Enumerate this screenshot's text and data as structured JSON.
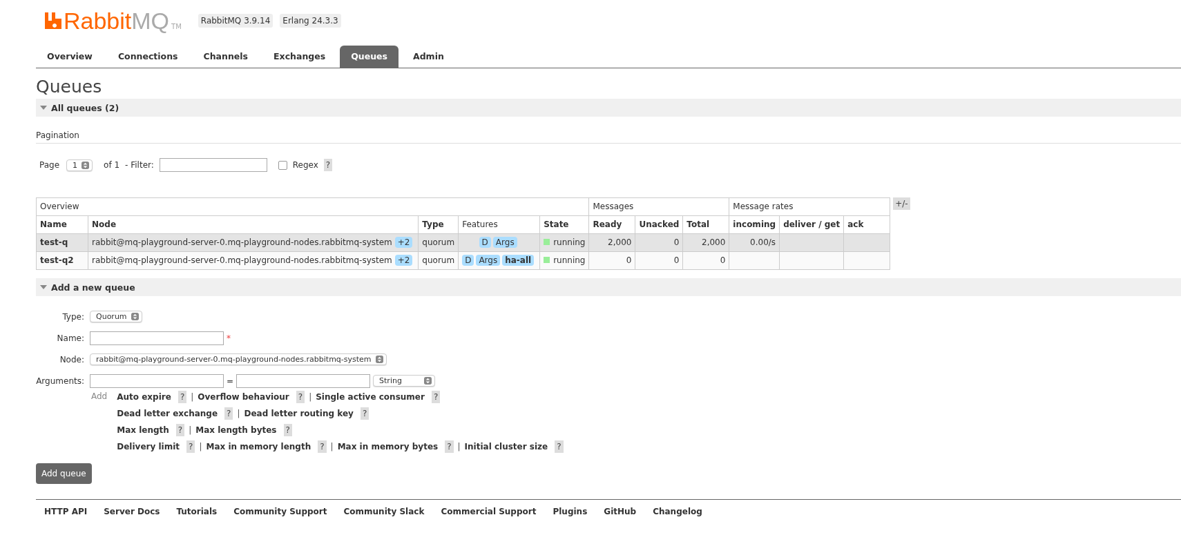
{
  "header": {
    "logo": {
      "brand": "Rabbit",
      "accent": "MQ",
      "mark": "TM"
    },
    "badges": [
      "RabbitMQ 3.9.14",
      "Erlang 24.3.3"
    ]
  },
  "tabs": [
    {
      "label": "Overview",
      "selected": false
    },
    {
      "label": "Connections",
      "selected": false
    },
    {
      "label": "Channels",
      "selected": false
    },
    {
      "label": "Exchanges",
      "selected": false
    },
    {
      "label": "Queues",
      "selected": true
    },
    {
      "label": "Admin",
      "selected": false
    }
  ],
  "page_title": "Queues",
  "all_queues": {
    "title": "All queues (2)",
    "expanded": true
  },
  "pagination": {
    "heading": "Pagination",
    "page_label": "Page",
    "page_value": "1",
    "of_label": "of 1",
    "filter_label": "- Filter:",
    "regex_label": "Regex",
    "regex_checked": false,
    "help": "?"
  },
  "table": {
    "groups": [
      "Overview",
      "Messages",
      "Message rates"
    ],
    "toggle": "+/-",
    "columns": [
      {
        "label": "Name",
        "bold": true
      },
      {
        "label": "Node",
        "bold": true
      },
      {
        "label": "Type",
        "bold": true
      },
      {
        "label": "Features",
        "bold": false
      },
      {
        "label": "State",
        "bold": true
      },
      {
        "label": "Ready",
        "bold": true
      },
      {
        "label": "Unacked",
        "bold": true
      },
      {
        "label": "Total",
        "bold": true
      },
      {
        "label": "incoming",
        "bold": true
      },
      {
        "label": "deliver / get",
        "bold": true
      },
      {
        "label": "ack",
        "bold": true
      }
    ],
    "rows": [
      {
        "selected": true,
        "name": "test-q",
        "node": "rabbit@mq-playground-server-0.mq-playground-nodes.rabbitmq-system",
        "node_extra": "+2",
        "type": "quorum",
        "features": [
          {
            "label": "D",
            "kind": "plain"
          },
          {
            "label": "Args",
            "kind": "plain"
          }
        ],
        "state": "running",
        "color": "#99ee99",
        "ready": "2,000",
        "unacked": "0",
        "total": "2,000",
        "incoming": "0.00/s",
        "deliver_get": "",
        "ack": ""
      },
      {
        "selected": false,
        "name": "test-q2",
        "node": "rabbit@mq-playground-server-0.mq-playground-nodes.rabbitmq-system",
        "node_extra": "+2",
        "type": "quorum",
        "features": [
          {
            "label": "D",
            "kind": "plain"
          },
          {
            "label": "Args",
            "kind": "plain"
          },
          {
            "label": "ha-all",
            "kind": "policy"
          }
        ],
        "state": "running",
        "color": "#99ee99",
        "ready": "0",
        "unacked": "0",
        "total": "0",
        "incoming": "",
        "deliver_get": "",
        "ack": ""
      }
    ]
  },
  "add_queue": {
    "title": "Add a new queue",
    "expanded": true,
    "type_label": "Type:",
    "type_value": "Quorum",
    "name_label": "Name:",
    "required_mark": "*",
    "node_label": "Node:",
    "node_value": "rabbit@mq-playground-server-0.mq-playground-nodes.rabbitmq-system",
    "arguments_label": "Arguments:",
    "equals": "=",
    "arg_type": "String",
    "add_label": "Add",
    "separator": "|",
    "help": "?",
    "argument_lines": [
      [
        "Auto expire",
        "Overflow behaviour",
        "Single active consumer"
      ],
      [
        "Dead letter exchange",
        "Dead letter routing key"
      ],
      [
        "Max length",
        "Max length bytes"
      ],
      [
        "Delivery limit",
        "Max in memory length",
        "Max in memory bytes",
        "Initial cluster size"
      ]
    ],
    "submit": "Add queue"
  },
  "footer": [
    "HTTP API",
    "Server Docs",
    "Tutorials",
    "Community Support",
    "Community Slack",
    "Commercial Support",
    "Plugins",
    "GitHub",
    "Changelog"
  ]
}
